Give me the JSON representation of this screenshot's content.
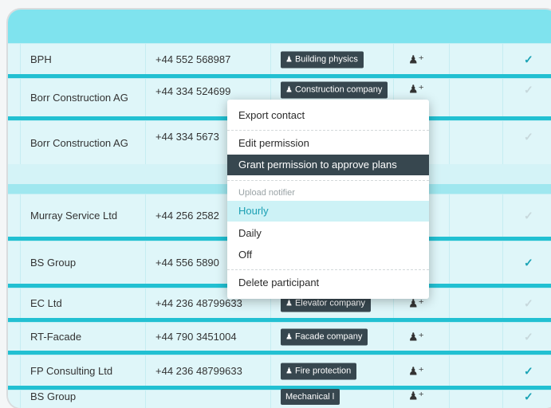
{
  "rows": [
    {
      "company": "BPH",
      "phone": "+44 552 568987",
      "tag": "Building physics",
      "icon": "user-group-icon",
      "approved": true
    },
    {
      "company": "Borr Construction AG",
      "phone": "+44 334 524699",
      "tag": "Construction company",
      "icon": "user-group-icon",
      "approved": false
    },
    {
      "company": "Borr Construction AG",
      "phone": "+44 334 5673",
      "tag": "",
      "icon": "",
      "approved": false
    },
    {
      "company": "Murray Service Ltd",
      "phone": "+44 256 2582",
      "tag": "",
      "icon": "",
      "approved": false
    },
    {
      "company": "BS Group",
      "phone": "+44 556 5890",
      "tag": "",
      "icon": "",
      "approved": true
    },
    {
      "company": "EC Ltd",
      "phone": "+44 236 48799633",
      "tag": "Elevator company",
      "icon": "user-group-icon",
      "approved": false
    },
    {
      "company": "RT-Facade",
      "phone": "+44 790 3451004",
      "tag": "Facade company",
      "icon": "user-group-icon",
      "approved": false
    },
    {
      "company": "FP Consulting Ltd",
      "phone": "+44 236 48799633",
      "tag": "Fire protection",
      "icon": "user-group-icon",
      "approved": true
    },
    {
      "company": "BS Group",
      "phone": "",
      "tag": "Mechanical l",
      "icon": "user-group-icon",
      "approved": true
    }
  ],
  "context_menu": {
    "export_contact": "Export contact",
    "edit_permission": "Edit permission",
    "grant_permission": "Grant permission to approve plans",
    "upload_notifier_label": "Upload notifier",
    "hourly": "Hourly",
    "daily": "Daily",
    "off": "Off",
    "delete_participant": "Delete participant"
  },
  "icons": {
    "tag_icon": "user-group-icon",
    "check_icon": "check-icon"
  },
  "colors": {
    "header": "#7fe3ee",
    "accent": "#22c0d2",
    "tag_bg": "#37474f",
    "selected_text": "#1a9fb3"
  }
}
